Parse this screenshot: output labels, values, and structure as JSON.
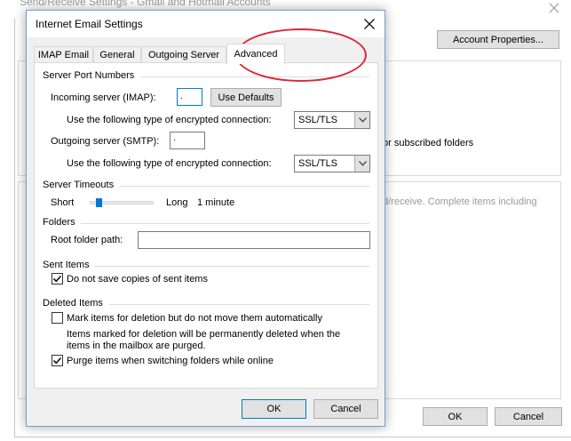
{
  "background_window": {
    "title": "Send/Receive Settings - Gmail and Hotmail Accounts",
    "account_properties_label": "Account Properties...",
    "subscribed_text": "or subscribed folders",
    "send_receive_text": "d/receive. Complete items including",
    "ok_label": "OK",
    "cancel_label": "Cancel"
  },
  "dialog": {
    "title": "Internet Email Settings",
    "tabs": [
      {
        "label": "IMAP Email"
      },
      {
        "label": "General"
      },
      {
        "label": "Outgoing Server"
      },
      {
        "label": "Advanced"
      }
    ],
    "active_tab": "Advanced",
    "server_ports": {
      "heading": "Server Port Numbers",
      "incoming_label": "Incoming server (IMAP):",
      "incoming_value": ".",
      "use_defaults_label": "Use Defaults",
      "encryption_label_1": "Use the following type of encrypted connection:",
      "encryption_value_1": "SSL/TLS",
      "outgoing_label": "Outgoing server (SMTP):",
      "outgoing_value": "·",
      "encryption_label_2": "Use the following type of encrypted connection:",
      "encryption_value_2": "SSL/TLS"
    },
    "timeouts": {
      "heading": "Server Timeouts",
      "short_label": "Short",
      "long_label": "Long",
      "value_label": "1 minute",
      "slider_level": 0.1
    },
    "folders": {
      "heading": "Folders",
      "root_label": "Root folder path:",
      "root_value": ""
    },
    "sent_items": {
      "heading": "Sent Items",
      "do_not_save_label": "Do not save copies of sent items",
      "do_not_save_checked": true
    },
    "deleted_items": {
      "heading": "Deleted Items",
      "mark_label": "Mark items for deletion but do not move them automatically",
      "mark_checked": false,
      "note_line1": "Items marked for deletion will be permanently deleted when the",
      "note_line2": "items in the mailbox are purged.",
      "purge_label": "Purge items when switching folders while online",
      "purge_checked": true
    },
    "ok_label": "OK",
    "cancel_label": "Cancel"
  },
  "colors": {
    "accent": "#0078d7",
    "annotation": "#d9293a"
  }
}
